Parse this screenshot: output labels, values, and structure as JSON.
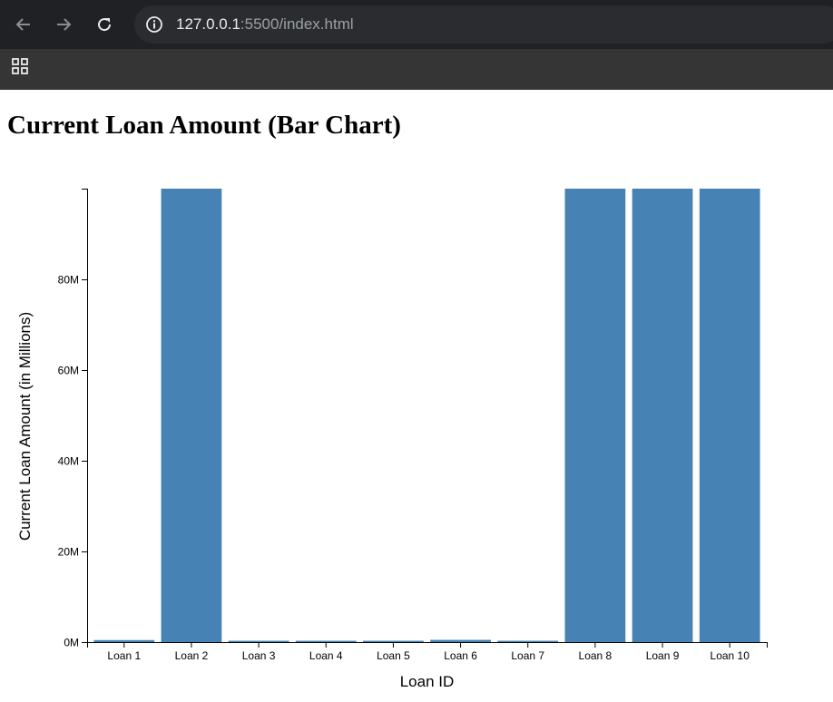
{
  "browser": {
    "url_host": "127.0.0.1",
    "url_rest": ":5500/index.html",
    "icons": [
      "back-arrow-icon",
      "forward-arrow-icon",
      "reload-icon",
      "info-icon",
      "apps-grid-icon"
    ]
  },
  "page": {
    "title": "Current Loan Amount (Bar Chart)"
  },
  "chart_data": {
    "type": "bar",
    "title": "Current Loan Amount (Bar Chart)",
    "xlabel": "Loan ID",
    "ylabel": "Current Loan Amount (in Millions)",
    "categories": [
      "Loan 1",
      "Loan 2",
      "Loan 3",
      "Loan 4",
      "Loan 5",
      "Loan 6",
      "Loan 7",
      "Loan 8",
      "Loan 9",
      "Loan 10"
    ],
    "values": [
      0.45,
      100,
      0.26,
      0.22,
      0.22,
      0.5,
      0.2,
      100,
      100,
      100
    ],
    "value_unit": "millions",
    "ylim": [
      0,
      100
    ],
    "yticks": [
      0,
      20,
      40,
      60,
      80
    ],
    "ytick_labels": [
      "0M",
      "20M",
      "40M",
      "60M",
      "80M"
    ],
    "bar_color": "#4682b4",
    "grid": false
  }
}
